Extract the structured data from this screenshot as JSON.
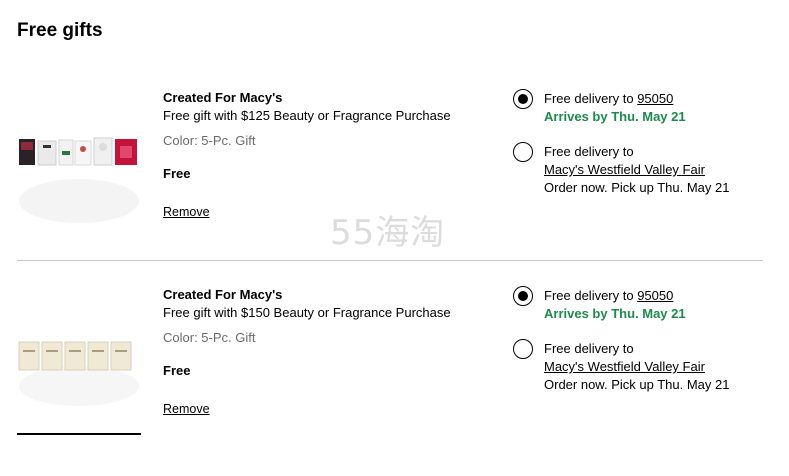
{
  "section": {
    "title": "Free gifts"
  },
  "items": [
    {
      "brand": "Created For Macy's",
      "description": "Free gift with $125 Beauty or Fragrance Purchase",
      "color": "Color: 5-Pc. Gift",
      "price": "Free",
      "remove_label": "Remove",
      "delivery": {
        "selected": true,
        "prefix": "Free delivery to ",
        "zip": "95050",
        "arrival": "Arrives by Thu. May 21"
      },
      "pickup": {
        "selected": false,
        "prefix": "Free delivery to",
        "store": "Macy's Westfield Valley Fair",
        "note": "Order now. Pick up Thu. May 21"
      }
    },
    {
      "brand": "Created For Macy's",
      "description": "Free gift with $150 Beauty or Fragrance Purchase",
      "color": "Color: 5-Pc. Gift",
      "price": "Free",
      "remove_label": "Remove",
      "delivery": {
        "selected": true,
        "prefix": "Free delivery to ",
        "zip": "95050",
        "arrival": "Arrives by Thu. May 21"
      },
      "pickup": {
        "selected": false,
        "prefix": "Free delivery to",
        "store": "Macy's Westfield Valley Fair",
        "note": "Order now. Pick up Thu. May 21"
      }
    }
  ],
  "watermark": "55海淘",
  "colors": {
    "accent_green": "#1d8a4c",
    "divider": "#c8c8c8"
  }
}
